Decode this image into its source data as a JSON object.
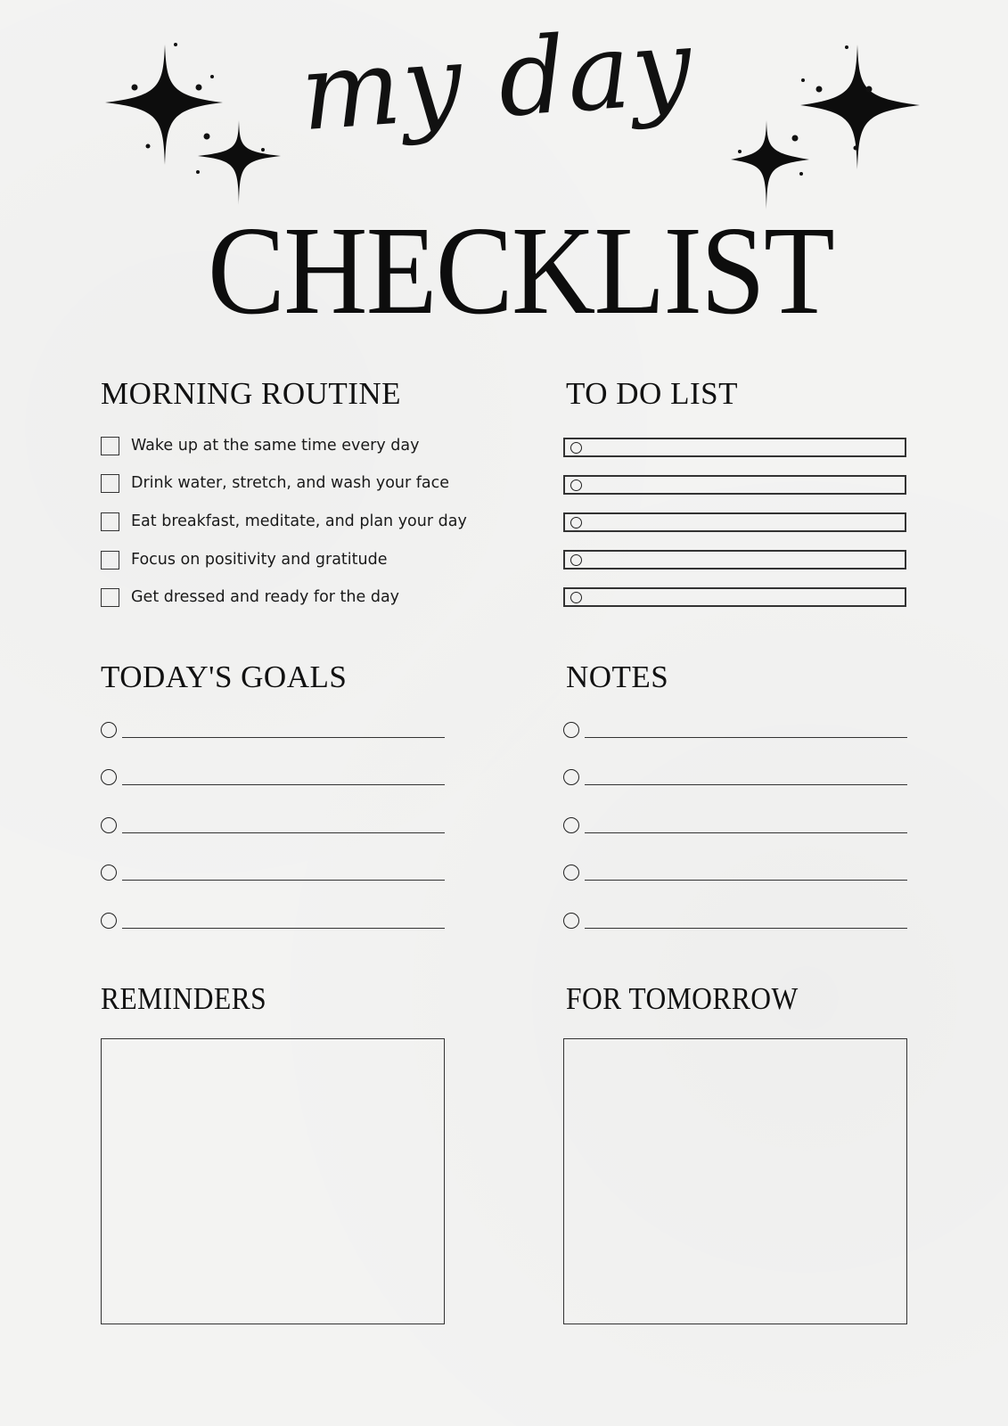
{
  "header": {
    "script_title": "my day",
    "main_title": "CHECKLIST"
  },
  "decorations": {
    "left_icon": "sparkle-cluster-icon",
    "right_icon": "sparkle-cluster-icon"
  },
  "morning_routine": {
    "heading": "MORNING ROUTINE",
    "items": [
      {
        "label": "Wake up at the same time every day",
        "checked": false
      },
      {
        "label": "Drink water, stretch, and wash your face",
        "checked": false
      },
      {
        "label": "Eat breakfast, meditate, and plan your day",
        "checked": false
      },
      {
        "label": "Focus on positivity and gratitude",
        "checked": false
      },
      {
        "label": "Get dressed and ready for the day",
        "checked": false
      }
    ]
  },
  "todo_list": {
    "heading": "TO DO LIST",
    "items": [
      "",
      "",
      "",
      "",
      ""
    ]
  },
  "todays_goals": {
    "heading": "TODAY'S GOALS",
    "items": [
      "",
      "",
      "",
      "",
      ""
    ]
  },
  "notes": {
    "heading": "NOTES",
    "items": [
      "",
      "",
      "",
      "",
      ""
    ]
  },
  "reminders": {
    "heading": "REMINDERS",
    "content": ""
  },
  "for_tomorrow": {
    "heading": "FOR TOMORROW",
    "content": ""
  },
  "colors": {
    "background": "#f3f3f2",
    "ink": "#111111",
    "rule": "#333333"
  }
}
